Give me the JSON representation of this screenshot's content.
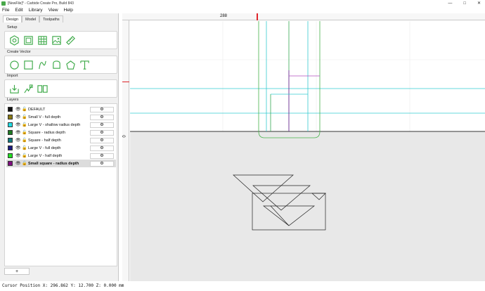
{
  "window": {
    "title": "[NewFile]* - Carbide Create Pro, Build 843",
    "controls": [
      "—",
      "□",
      "✕"
    ]
  },
  "menu": [
    "File",
    "Edit",
    "Library",
    "View",
    "Help"
  ],
  "tabs": [
    {
      "label": "Design",
      "active": true
    },
    {
      "label": "Model",
      "active": false
    },
    {
      "label": "Toolpaths",
      "active": false
    }
  ],
  "sections": {
    "setup": "Setup",
    "create_vector": "Create Vector",
    "import": "Import",
    "layers": "Layers"
  },
  "icons": {
    "setup": [
      "settings-gear-icon",
      "square-icon",
      "grid-icon",
      "image-icon",
      "ruler-icon"
    ],
    "create_vector": [
      "circle-icon",
      "rectangle-icon",
      "curve-icon",
      "polygon-shape-icon",
      "pentagon-icon",
      "text-icon"
    ],
    "import": [
      "import-icon",
      "import-vector-icon",
      "book-library-icon"
    ],
    "accent_color": "#3aa845"
  },
  "layers": [
    {
      "name": "DEFAULT",
      "color": "#111111",
      "selected": false
    },
    {
      "name": "Small V - full depth",
      "color": "#8a7a14",
      "selected": false
    },
    {
      "name": "Large V - shallow radius depth",
      "color": "#22dde4",
      "selected": false
    },
    {
      "name": "Square - radius depth",
      "color": "#1e7a22",
      "selected": false
    },
    {
      "name": "Square - half depth",
      "color": "#127a80",
      "selected": false
    },
    {
      "name": "Large V - full depth",
      "color": "#1c1a80",
      "selected": false
    },
    {
      "name": "Large V - half depth",
      "color": "#22e022",
      "selected": false
    },
    {
      "name": "Small square - radius depth",
      "color": "#800c80",
      "selected": true
    }
  ],
  "add_layer_label": "+",
  "ruler": {
    "top_value": "288",
    "left_value": "0"
  },
  "status": "Cursor Position X: 296.862 Y: 12.700 Z: 0.000 mm"
}
